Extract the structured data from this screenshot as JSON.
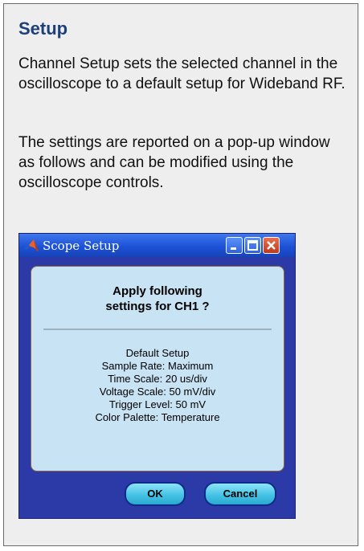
{
  "panel": {
    "title": "Setup",
    "paragraph1": "Channel Setup sets the selected channel in the oscilloscope to a default setup for Wideband RF.",
    "paragraph2": "The settings are reported on a pop-up window as follows and can be modified using the oscilloscope controls."
  },
  "dialog": {
    "title": "Scope Setup",
    "question_line1": "Apply following",
    "question_line2": "settings for CH1 ?",
    "settings": [
      "Default Setup",
      "Sample Rate: Maximum",
      "Time Scale: 20 us/div",
      "Voltage Scale: 50 mV/div",
      "Trigger Level: 50 mV",
      "Color Palette: Temperature"
    ],
    "ok_label": "OK",
    "cancel_label": "Cancel",
    "icons": {
      "app": "matlab-logo-icon",
      "minimize": "minimize-icon",
      "maximize": "maximize-icon",
      "close": "close-icon"
    }
  }
}
